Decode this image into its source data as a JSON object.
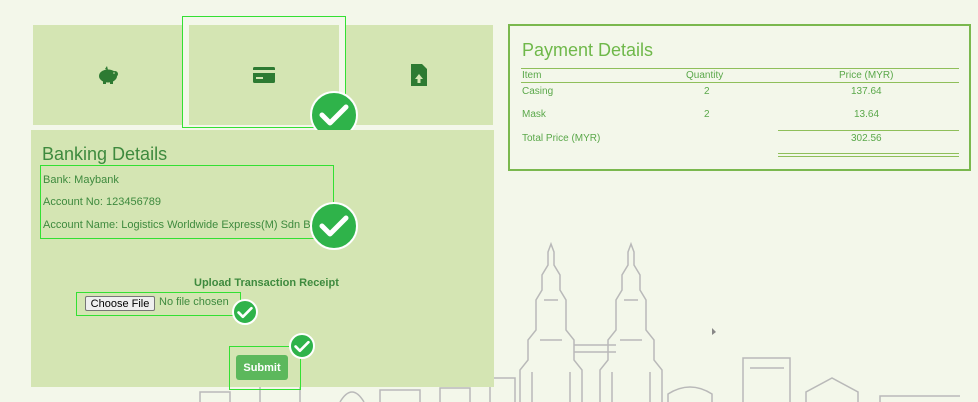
{
  "methods": [
    {
      "icon": "piggy-bank-icon"
    },
    {
      "icon": "credit-card-icon",
      "selected": true
    },
    {
      "icon": "upload-document-icon"
    }
  ],
  "banking": {
    "title": "Banking Details",
    "bank": "Bank: Maybank",
    "account_no": "Account No: 123456789",
    "account_name": "Account Name: Logistics Worldwide Express(M) Sdn Bhd",
    "upload_label": "Upload Transaction Receipt",
    "file_button": "Choose File",
    "file_status": "No file chosen",
    "submit": "Submit"
  },
  "payment": {
    "title": "Payment Details",
    "headers": [
      "Item",
      "Quantity",
      "Price (MYR)"
    ],
    "rows": [
      {
        "item": "Casing",
        "quantity": "2",
        "price": "137.64"
      },
      {
        "item": "Mask",
        "quantity": "2",
        "price": "13.64"
      }
    ],
    "total_label": "Total Price (MYR)",
    "total_value": "302.56"
  },
  "colors": {
    "panel": "#d4e5b3",
    "accent": "#3e8a3e",
    "check": "#2fb34a",
    "highlight": "#33e033",
    "submit": "#5cb85c"
  }
}
